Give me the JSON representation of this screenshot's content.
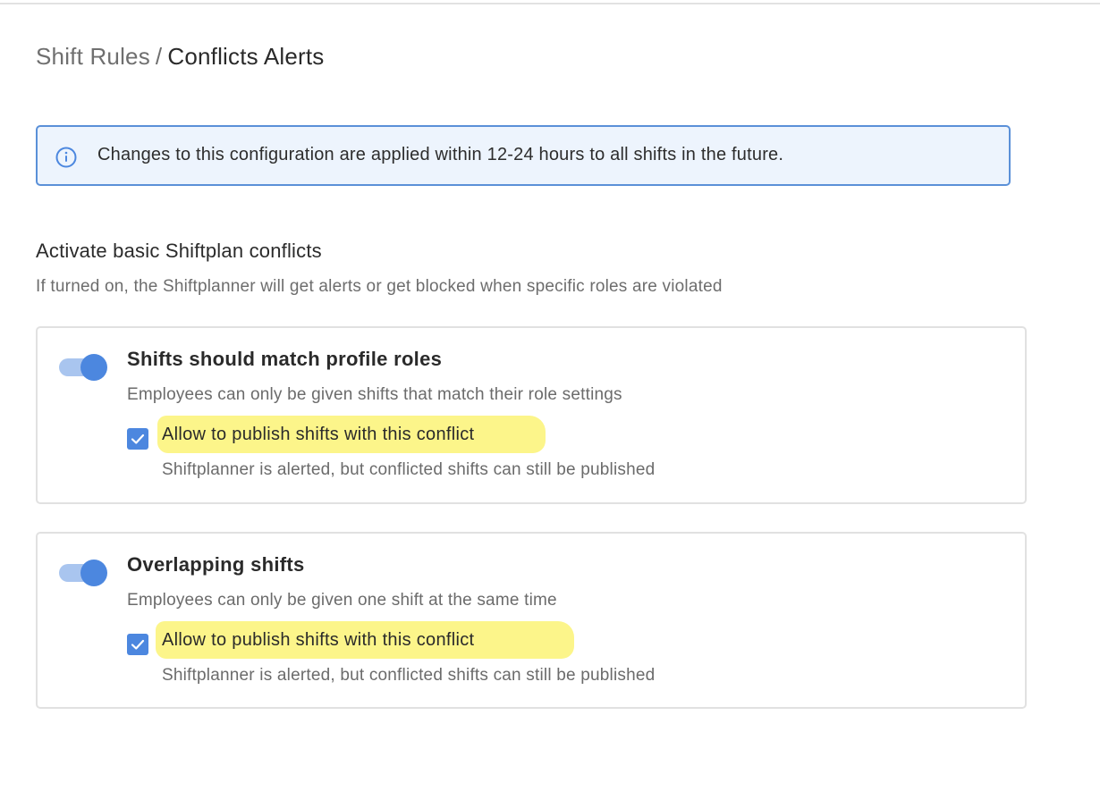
{
  "breadcrumb": {
    "parent": "Shift Rules",
    "separator": "/",
    "current": "Conflicts Alerts"
  },
  "info_banner": {
    "icon": "info-icon",
    "text": "Changes to this configuration are applied within 12-24 hours to all shifts in the future."
  },
  "section": {
    "title": "Activate basic Shiftplan conflicts",
    "subtitle": "If turned on, the Shiftplanner will get alerts or get blocked when specific roles are violated"
  },
  "rules": [
    {
      "enabled": true,
      "title": "Shifts should match profile roles",
      "description": "Employees can only be given shifts that match their role settings",
      "checkbox_checked": true,
      "checkbox_label": "Allow to publish shifts with this conflict",
      "checkbox_help": "Shiftplanner is alerted, but conflicted shifts can still be published"
    },
    {
      "enabled": true,
      "title": "Overlapping shifts",
      "description": "Employees can only be given one shift at the same time",
      "checkbox_checked": true,
      "checkbox_label": "Allow to publish shifts with this conflict",
      "checkbox_help": "Shiftplanner is alerted, but conflicted shifts can still be published"
    }
  ],
  "colors": {
    "accent": "#4c87df",
    "toggle_track": "#a9c5ef",
    "banner_border": "#5a90d8",
    "banner_bg": "#edf4fd",
    "highlight": "#fcf58a",
    "card_border": "#e1e1e1"
  }
}
